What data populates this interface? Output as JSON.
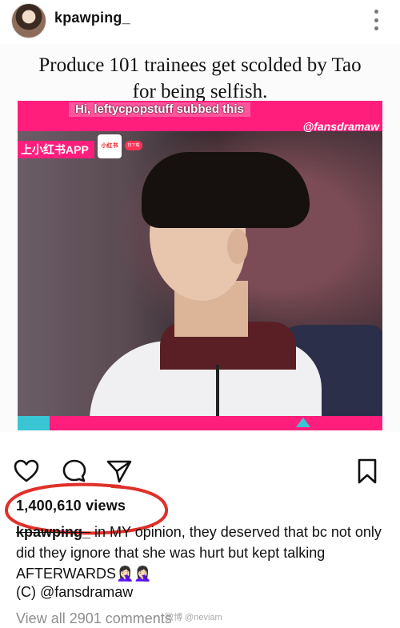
{
  "header": {
    "username": "kpawping_"
  },
  "post": {
    "headline_line1": "Produce 101 trainees get scolded by Tao",
    "headline_line2": "for being selfish.",
    "video": {
      "subtitle_credit": "Hi, leftycpopstuff subbed this",
      "watermark": "@fansdramaw",
      "app_label": "上小红书APP",
      "app_badge": "小红书",
      "app_badge2": "扫下载"
    }
  },
  "engagement": {
    "views": "1,400,610 views"
  },
  "caption": {
    "user": "kpawping_",
    "text": " in MY opinion, they deserved that bc not only did they ignore that she was hurt but kept talking AFTERWARDS🤦🏻‍♀️🤦🏻‍♀️",
    "credit": "(C) @fansdramaw"
  },
  "comments": {
    "view_all": "View all 2901 comments",
    "weibo_watermark": "微博 @neviam"
  },
  "colors": {
    "pink_band": "#ff1e7c",
    "teal_accent": "#39c5d3",
    "annotation_red": "#e0302a"
  },
  "icons": [
    "heart-icon",
    "comment-icon",
    "share-icon",
    "bookmark-icon",
    "more-options-icon"
  ]
}
